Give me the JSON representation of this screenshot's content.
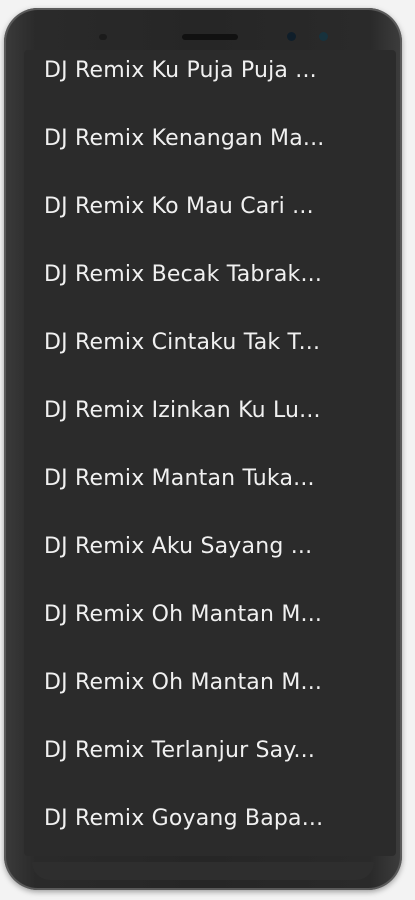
{
  "playlist": {
    "items": [
      {
        "label": "DJ Remix Ku Puja Puja ..."
      },
      {
        "label": "DJ Remix Kenangan Ma..."
      },
      {
        "label": "DJ Remix Ko Mau Cari ..."
      },
      {
        "label": "DJ Remix Becak Tabrak..."
      },
      {
        "label": "DJ Remix Cintaku Tak T..."
      },
      {
        "label": "DJ Remix Izinkan Ku Lu..."
      },
      {
        "label": "DJ Remix Mantan Tuka..."
      },
      {
        "label": "DJ Remix Aku Sayang ..."
      },
      {
        "label": "DJ Remix Oh Mantan M..."
      },
      {
        "label": "DJ Remix Oh Mantan M..."
      },
      {
        "label": "DJ Remix Terlanjur Say..."
      },
      {
        "label": "DJ Remix Goyang Bapa..."
      }
    ]
  }
}
